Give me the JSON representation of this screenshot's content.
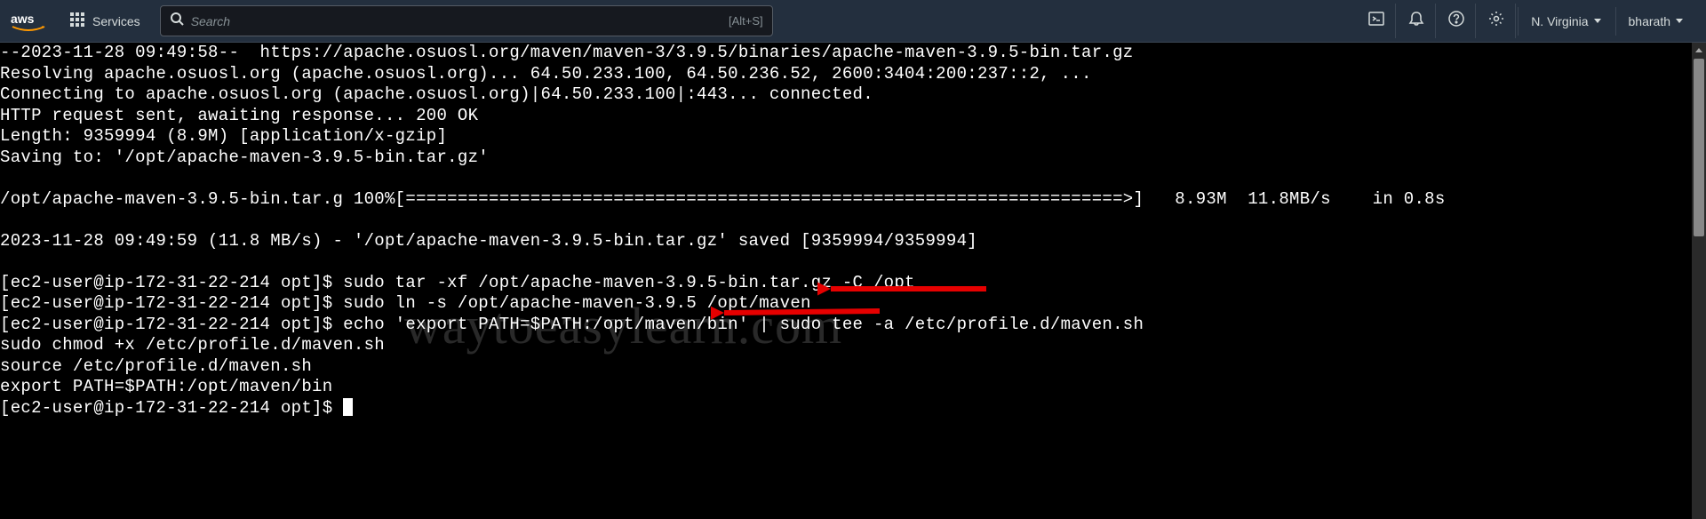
{
  "header": {
    "services_label": "Services",
    "search_placeholder": "Search",
    "search_shortcut": "[Alt+S]",
    "region": "N. Virginia",
    "user": "bharath"
  },
  "terminal": {
    "lines": [
      "--2023-11-28 09:49:58--  https://apache.osuosl.org/maven/maven-3/3.9.5/binaries/apache-maven-3.9.5-bin.tar.gz",
      "Resolving apache.osuosl.org (apache.osuosl.org)... 64.50.233.100, 64.50.236.52, 2600:3404:200:237::2, ...",
      "Connecting to apache.osuosl.org (apache.osuosl.org)|64.50.233.100|:443... connected.",
      "HTTP request sent, awaiting response... 200 OK",
      "Length: 9359994 (8.9M) [application/x-gzip]",
      "Saving to: '/opt/apache-maven-3.9.5-bin.tar.gz'",
      "",
      "/opt/apache-maven-3.9.5-bin.tar.g 100%[=====================================================================>]   8.93M  11.8MB/s    in 0.8s",
      "",
      "2023-11-28 09:49:59 (11.8 MB/s) - '/opt/apache-maven-3.9.5-bin.tar.gz' saved [9359994/9359994]",
      "",
      "[ec2-user@ip-172-31-22-214 opt]$ sudo tar -xf /opt/apache-maven-3.9.5-bin.tar.gz -C /opt",
      "[ec2-user@ip-172-31-22-214 opt]$ sudo ln -s /opt/apache-maven-3.9.5 /opt/maven",
      "[ec2-user@ip-172-31-22-214 opt]$ echo 'export PATH=$PATH:/opt/maven/bin' | sudo tee -a /etc/profile.d/maven.sh",
      "sudo chmod +x /etc/profile.d/maven.sh",
      "source /etc/profile.d/maven.sh",
      "export PATH=$PATH:/opt/maven/bin",
      "[ec2-user@ip-172-31-22-214 opt]$ "
    ]
  },
  "watermark_text": "waytoeasylearn.com"
}
